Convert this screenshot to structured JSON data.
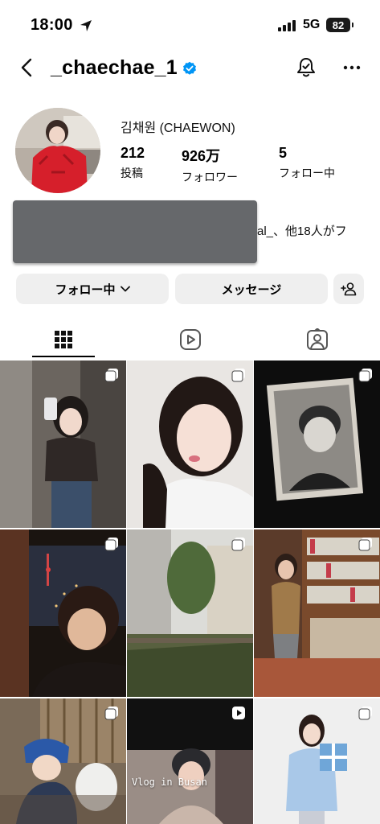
{
  "status_bar": {
    "time": "18:00",
    "network": "5G",
    "battery": "82"
  },
  "header": {
    "username": "_chaechae_1",
    "icons": [
      "back-icon",
      "verified-icon",
      "notification-bell-icon",
      "more-icon"
    ]
  },
  "profile": {
    "display_name": "김채원 (CHAEWON)",
    "stats": [
      {
        "value": "212",
        "label": "投稿"
      },
      {
        "value": "926万",
        "label": "フォロワー"
      },
      {
        "value": "5",
        "label": "フォロー中"
      }
    ],
    "mutual_followers_text": "al_、他18人がフ"
  },
  "actions": {
    "following_label": "フォロー中",
    "message_label": "メッセージ"
  },
  "tabs": [
    "grid-icon",
    "reels-icon",
    "tagged-icon"
  ],
  "grid": {
    "vlog_caption": "Vlog           in Busan",
    "badges": [
      "multi-photo",
      "multi-photo",
      "multi-photo",
      "multi-photo",
      "multi-photo",
      "multi-photo",
      "multi-photo",
      "reel",
      "multi-photo"
    ]
  },
  "colors": {
    "verified": "#0095f6",
    "button_bg": "#efefef",
    "redaction": "#66686b"
  }
}
